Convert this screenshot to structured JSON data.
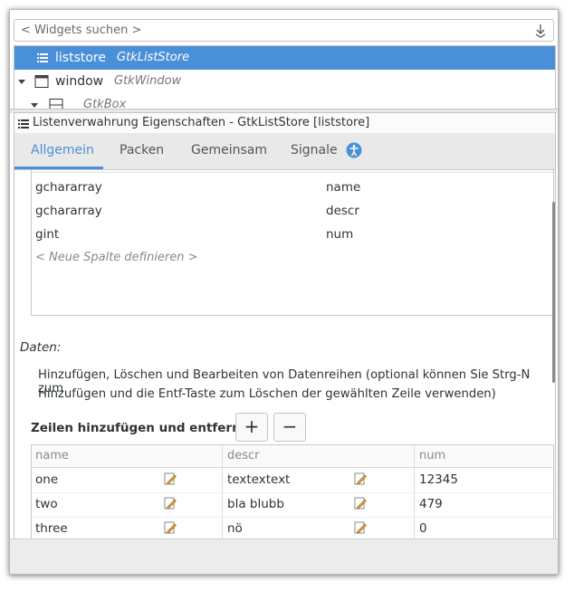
{
  "search": {
    "placeholder": "< Widgets suchen >",
    "icon": "download-arrow-icon"
  },
  "tree": {
    "rows": [
      {
        "label": "liststore",
        "type": "GtkListStore",
        "selected": true
      },
      {
        "label": "window",
        "type": "GtkWindow",
        "selected": false
      },
      {
        "label": "",
        "type": "GtkBox",
        "selected": false
      }
    ]
  },
  "editor": {
    "title": "Listenverwahrung Eigenschaften - GtkListStore [liststore]",
    "tabs": [
      "Allgemein",
      "Packen",
      "Gemeinsam",
      "Signale"
    ],
    "active_tab": "Allgemein",
    "columns": [
      {
        "type": "gchararray",
        "name": "name"
      },
      {
        "type": "gchararray",
        "name": "descr"
      },
      {
        "type": "gint",
        "name": "num"
      }
    ],
    "define_column": "< Neue Spalte definieren >",
    "data_label": "Daten:",
    "help_line1": "Hinzufügen, Löschen und Bearbeiten von Datenreihen (optional können Sie Strg-N zum",
    "help_line2": "Hinzufügen und die Entf-Taste zum Löschen der gewählten Zeile verwenden)",
    "rows_label": "Zeilen hinzufügen und entfernen:",
    "add_label": "+",
    "remove_label": "−",
    "grid_headers": [
      "name",
      "descr",
      "num"
    ],
    "grid_rows": [
      [
        "one",
        "textextext",
        "12345"
      ],
      [
        "two",
        "bla blubb",
        "479"
      ],
      [
        "three",
        "nö",
        "0"
      ]
    ]
  },
  "colors": {
    "accent": "#4a90d9",
    "selection": "#4a90d9"
  }
}
